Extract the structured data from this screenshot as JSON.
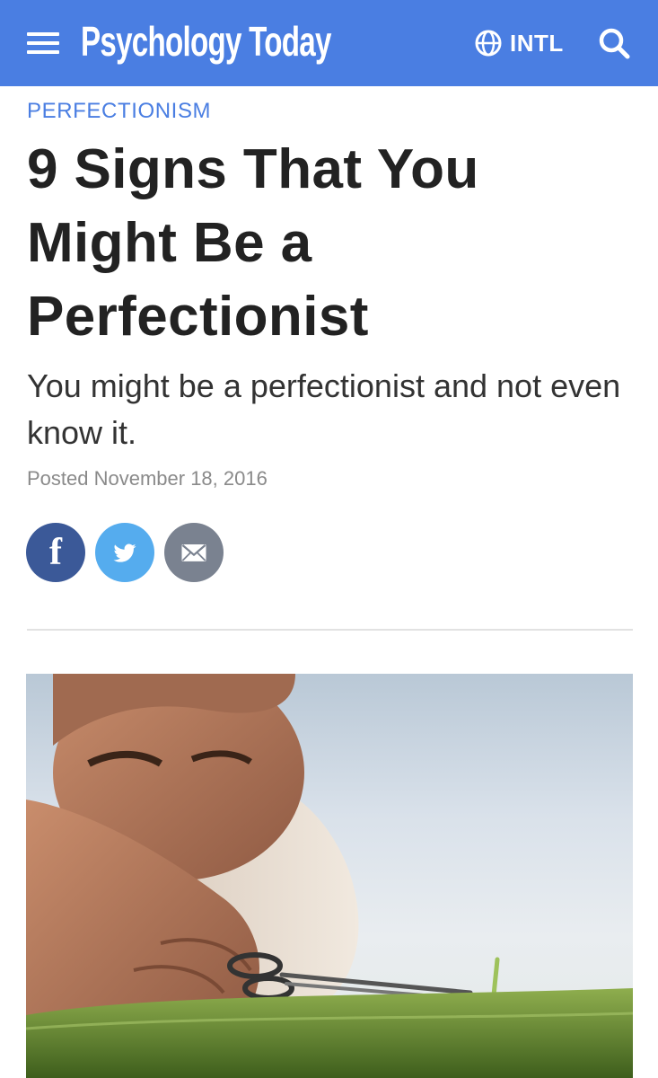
{
  "header": {
    "logo_text": "Psychology Today",
    "intl_label": "INTL",
    "menu_icon": "hamburger-menu-icon",
    "globe_icon": "globe-icon",
    "search_icon": "search-icon",
    "bar_color": "#4a7ee2"
  },
  "article": {
    "category": "PERFECTIONISM",
    "title": "9 Signs That You Might Be a Perfectionist",
    "subtitle": "You might be a perfectionist and not even know it.",
    "posted": "Posted November 18, 2016",
    "share": [
      {
        "name": "facebook",
        "icon": "facebook-icon",
        "color": "#3b5998"
      },
      {
        "name": "twitter",
        "icon": "twitter-icon",
        "color": "#55acee"
      },
      {
        "name": "email",
        "icon": "email-icon",
        "color": "#7a8290"
      }
    ],
    "image_alt": "Man trimming a single blade of grass with scissors"
  }
}
